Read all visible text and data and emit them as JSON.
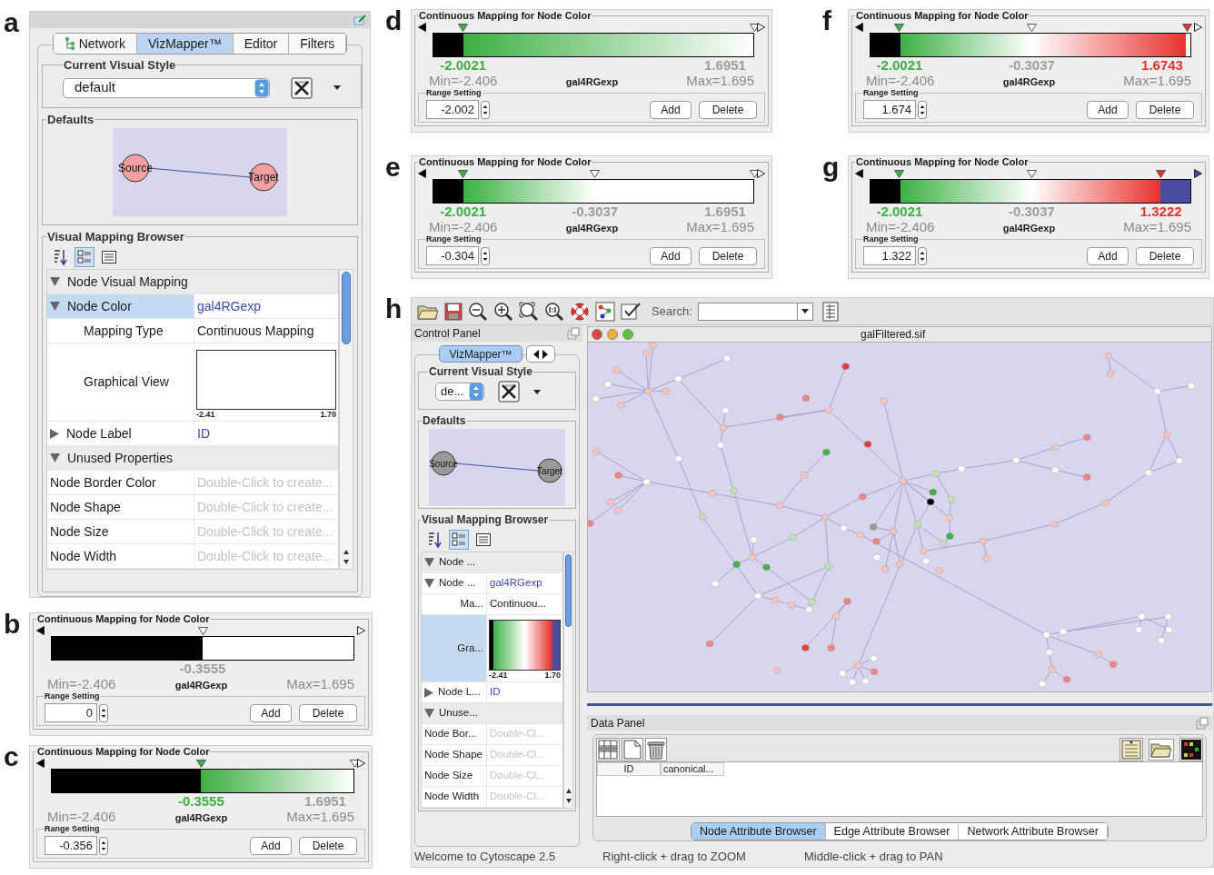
{
  "panel_a": {
    "label": "a",
    "tabs": [
      {
        "label": "Network",
        "selected": false
      },
      {
        "label": "VizMapper™",
        "selected": true
      },
      {
        "label": "Editor",
        "selected": false
      },
      {
        "label": "Filters",
        "selected": false
      }
    ],
    "style_group": "Current Visual Style",
    "style_value": "default",
    "defaults_group": "Defaults",
    "defaults": {
      "source": "Source",
      "target": "Target"
    },
    "browser_title": "Visual Mapping Browser",
    "view_modes": [
      {
        "kind": "sort",
        "selected": false
      },
      {
        "kind": "category",
        "selected": true
      },
      {
        "kind": "list",
        "selected": false
      }
    ],
    "rows": [
      {
        "kind": "category",
        "name": "Node Visual Mapping",
        "expanded": true,
        "selected": false
      },
      {
        "kind": "mapped",
        "name": "Node Color",
        "value": "gal4RGexp",
        "expanded": true,
        "selected": true
      },
      {
        "kind": "child",
        "name": "Mapping Type",
        "value": "Continuous Mapping",
        "selected": false
      },
      {
        "kind": "graph",
        "name": "Graphical View",
        "min": "-2.41",
        "max": "1.70",
        "filled": false,
        "selected": false
      },
      {
        "kind": "mapped",
        "name": "Node Label",
        "value": "ID",
        "expanded": false,
        "selected": false
      },
      {
        "kind": "category",
        "name": "Unused Properties",
        "expanded": true,
        "selected": false
      },
      {
        "kind": "unused",
        "name": "Node Border Color",
        "value": "Double-Click to create...",
        "selected": false
      },
      {
        "kind": "unused",
        "name": "Node Shape",
        "value": "Double-Click to create...",
        "selected": false
      },
      {
        "kind": "unused",
        "name": "Node Size",
        "value": "Double-Click to create...",
        "selected": false
      },
      {
        "kind": "unused",
        "name": "Node Width",
        "value": "Double-Click to create...",
        "selected": false
      }
    ]
  },
  "mappings": [
    {
      "label": "b",
      "title": "Continuous Mapping for Node Color",
      "below": {
        "color": "#000000"
      },
      "above": {
        "color": "#ffffff"
      },
      "handles": [
        {
          "level": 0.5,
          "color": "#ffffff",
          "value": "-0.3555"
        }
      ],
      "min": "Min=-2.406",
      "attribute": "gal4RGexp",
      "max": "Max=1.695",
      "range_title": "Range Setting",
      "range_value": "0",
      "buttons": [
        "Add",
        "Delete"
      ]
    },
    {
      "label": "c",
      "title": "Continuous Mapping for Node Color",
      "below": {
        "color": "#000000"
      },
      "above": {
        "color": "#ffffff"
      },
      "handles": [
        {
          "level": 0.495,
          "color": "#3cb043",
          "value": "-0.3555"
        },
        {
          "level": 1,
          "color": "#ffffff",
          "value": "1.6951"
        }
      ],
      "min": "Min=-2.406",
      "attribute": "gal4RGexp",
      "max": "Max=1.695",
      "range_title": "Range Setting",
      "range_value": "-0.356",
      "buttons": [
        "Add",
        "Delete"
      ]
    },
    {
      "label": "d",
      "title": "Continuous Mapping for Node Color",
      "below": {
        "color": "#000000"
      },
      "above": {
        "color": "#ffffff"
      },
      "handles": [
        {
          "level": 0.095,
          "color": "#3cb043",
          "value": "-2.0021"
        },
        {
          "level": 1,
          "color": "#ffffff",
          "value": "1.6951"
        }
      ],
      "min": "Min=-2.406",
      "attribute": "gal4RGexp",
      "max": "Max=1.695",
      "range_title": "Range Setting",
      "range_value": "-2.002",
      "buttons": [
        "Add",
        "Delete"
      ]
    },
    {
      "label": "e",
      "title": "Continuous Mapping for Node Color",
      "below": {
        "color": "#000000"
      },
      "above": {
        "color": "#ffffff"
      },
      "handles": [
        {
          "level": 0.095,
          "color": "#3cb043",
          "value": "-2.0021"
        },
        {
          "level": 0.505,
          "color": "#ffffff",
          "value": "-0.3037"
        },
        {
          "level": 1,
          "color": "#ffffff",
          "value": "1.6951"
        }
      ],
      "min": "Min=-2.406",
      "attribute": "gal4RGexp",
      "max": "Max=1.695",
      "range_title": "Range Setting",
      "range_value": "-0.304",
      "buttons": [
        "Add",
        "Delete"
      ]
    },
    {
      "label": "f",
      "title": "Continuous Mapping for Node Color",
      "below": {
        "color": "#000000"
      },
      "above": {
        "color": "#ffffff"
      },
      "handles": [
        {
          "level": 0.093,
          "color": "#3cb043",
          "value": "-2.0021"
        },
        {
          "level": 0.504,
          "color": "#ffffff",
          "value": "-0.3037"
        },
        {
          "level": 0.986,
          "color": "#e8322e",
          "value": "1.6743"
        }
      ],
      "min": "Min=-2.406",
      "attribute": "gal4RGexp",
      "max": "Max=1.695",
      "range_title": "Range Setting",
      "range_value": "1.674",
      "buttons": [
        "Add",
        "Delete"
      ]
    },
    {
      "label": "g",
      "title": "Continuous Mapping for Node Color",
      "below": {
        "color": "#000000"
      },
      "above": {
        "color": "#4b4ba0"
      },
      "handles": [
        {
          "level": 0.093,
          "color": "#3cb043",
          "value": "-2.0021"
        },
        {
          "level": 0.504,
          "color": "#ffffff",
          "value": "-0.3037"
        },
        {
          "level": 0.906,
          "color": "#e8322e",
          "value": "1.3222"
        }
      ],
      "min": "Min=-2.406",
      "attribute": "gal4RGexp",
      "max": "Max=1.695",
      "range_title": "Range Setting",
      "range_value": "1.322",
      "buttons": [
        "Add",
        "Delete"
      ]
    }
  ],
  "panel_h": {
    "label": "h",
    "search_label": "Search:",
    "control_panel_title": "Control Panel",
    "tabs": [
      {
        "label": "VizMapper™",
        "selected": true
      }
    ],
    "style_group": "Current Visual Style",
    "style_value": "de...",
    "defaults_group": "Defaults",
    "defaults": {
      "source": "Source",
      "target": "Target"
    },
    "browser_title": "Visual Mapping Browser",
    "view_modes": [
      {
        "kind": "sort",
        "selected": false
      },
      {
        "kind": "category",
        "selected": true
      },
      {
        "kind": "list",
        "selected": false
      }
    ],
    "rows": [
      {
        "kind": "category",
        "name": "Node ...",
        "expanded": true,
        "selected": false
      },
      {
        "kind": "mapped",
        "name": "Node ...",
        "value": "gal4RGexp",
        "expanded": true,
        "selected": false
      },
      {
        "kind": "child",
        "name": "Ma...",
        "value": "Continuou...",
        "selected": false
      },
      {
        "kind": "graph",
        "name": "Gra...",
        "min": "-2.41",
        "max": "1.70",
        "filled": true,
        "selected": true
      },
      {
        "kind": "mapped",
        "name": "Node L...",
        "value": "ID",
        "expanded": false,
        "selected": false
      },
      {
        "kind": "category",
        "name": "Unuse...",
        "expanded": true,
        "selected": false
      },
      {
        "kind": "unused",
        "name": "Node Bor...",
        "value": "Double-Cl...",
        "selected": false
      },
      {
        "kind": "unused",
        "name": "Node Shape",
        "value": "Double-Cl...",
        "selected": false
      },
      {
        "kind": "unused",
        "name": "Node Size",
        "value": "Double-Cl...",
        "selected": false
      },
      {
        "kind": "unused",
        "name": "Node Width",
        "value": "Double-Cl...",
        "selected": false
      }
    ],
    "network_title": "galFiltered.sif",
    "data_panel_title": "Data Panel",
    "columns": [
      "ID",
      "canonical..."
    ],
    "browser_tabs": [
      {
        "label": "Node Attribute Browser",
        "selected": true
      },
      {
        "label": "Edge Attribute Browser",
        "selected": false
      },
      {
        "label": "Network Attribute Browser",
        "selected": false
      }
    ],
    "status": [
      "Welcome to Cytoscape 2.5",
      "Right-click + drag to ZOOM",
      "Middle-click + drag to PAN"
    ]
  }
}
